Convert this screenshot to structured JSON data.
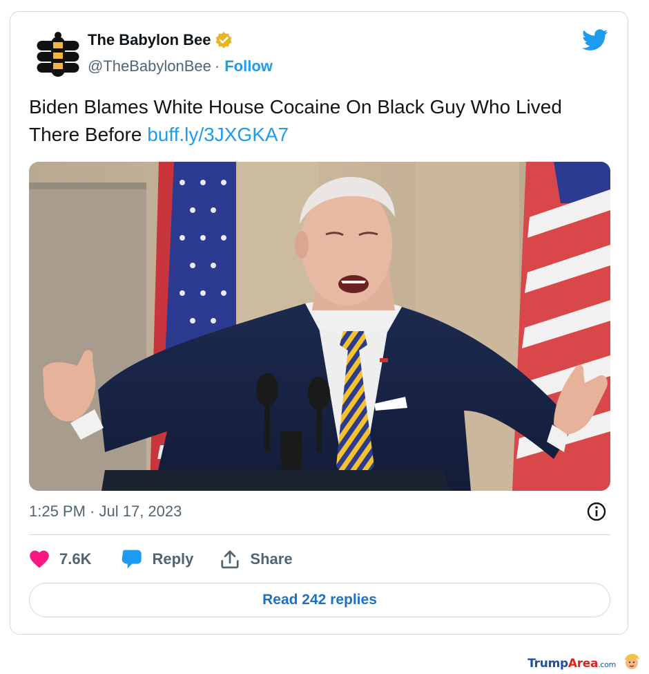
{
  "account": {
    "display_name": "The Babylon Bee",
    "handle": "@TheBabylonBee",
    "separator": "·",
    "follow_label": "Follow",
    "avatar_icon": "babylon-bee-logo-icon",
    "verified_icon": "verified-badge-icon",
    "verified_color": "#e8b420"
  },
  "platform": {
    "logo_icon": "twitter-bird-icon",
    "brand_color": "#1d9bf0"
  },
  "tweet": {
    "text": "Biden Blames White House Cocaine On Black Guy Who Lived There Before",
    "link": "buff.ly/3JXGKA7",
    "image_icon": "photo-biden-speaking-at-podium",
    "timestamp": "1:25 PM · Jul 17, 2023",
    "info_icon": "info-icon"
  },
  "actions": {
    "like_count": "7.6K",
    "like_icon": "heart-icon",
    "like_color": "#f91880",
    "reply_label": "Reply",
    "reply_icon": "speech-bubble-icon",
    "share_label": "Share",
    "share_icon": "share-upload-icon"
  },
  "read_replies_label": "Read 242 replies",
  "watermark": {
    "part1": "Trump",
    "part2": "Area",
    "part3": ".com",
    "icon": "trump-face-icon"
  }
}
